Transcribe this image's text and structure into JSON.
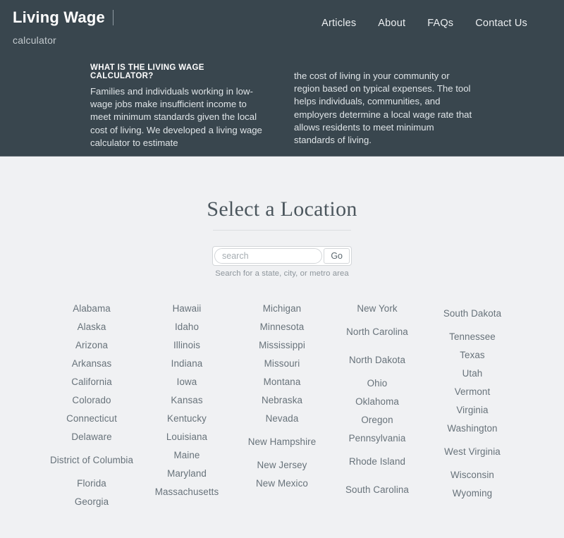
{
  "header": {
    "brand_title": "Living Wage",
    "brand_subtitle": "calculator",
    "nav": [
      {
        "label": "Articles"
      },
      {
        "label": "About"
      },
      {
        "label": "FAQs"
      },
      {
        "label": "Contact Us"
      }
    ],
    "intro_heading": "WHAT IS THE LIVING WAGE CALCULATOR?",
    "intro_left": "Families and individuals working in low-wage jobs make insufficient income to meet minimum standards given the local cost of living. We developed a living wage calculator to estimate",
    "intro_right": "the cost of living in your community or region based on typical expenses. The tool helps individuals, communities, and employers determine a local wage rate that allows residents to meet minimum standards of living."
  },
  "main": {
    "title": "Select a Location",
    "search": {
      "value": "",
      "placeholder": "search",
      "go_label": "Go",
      "hint": "Search for a state, city, or metro area"
    },
    "state_columns": [
      [
        "Alabama",
        "Alaska",
        "Arizona",
        "Arkansas",
        "California",
        "Colorado",
        "Connecticut",
        "Delaware",
        "District of Columbia",
        "Florida",
        "Georgia"
      ],
      [
        "Hawaii",
        "Idaho",
        "Illinois",
        "Indiana",
        "Iowa",
        "Kansas",
        "Kentucky",
        "Louisiana",
        "Maine",
        "Maryland",
        "Massachusetts"
      ],
      [
        "Michigan",
        "Minnesota",
        "Mississippi",
        "Missouri",
        "Montana",
        "Nebraska",
        "Nevada",
        "New Hampshire",
        "New Jersey",
        "New Mexico"
      ],
      [
        "New York",
        "North Carolina",
        "North Dakota",
        "Ohio",
        "Oklahoma",
        "Oregon",
        "Pennsylvania",
        "Rhode Island",
        "South Carolina"
      ],
      [
        "South Dakota",
        "Tennessee",
        "Texas",
        "Utah",
        "Vermont",
        "Virginia",
        "Washington",
        "West Virginia",
        "Wisconsin",
        "Wyoming"
      ]
    ]
  },
  "colors": {
    "header_bg": "#39464e",
    "body_bg": "#f0f1f3",
    "title_text": "#4c575e",
    "state_link": "#67727a"
  }
}
